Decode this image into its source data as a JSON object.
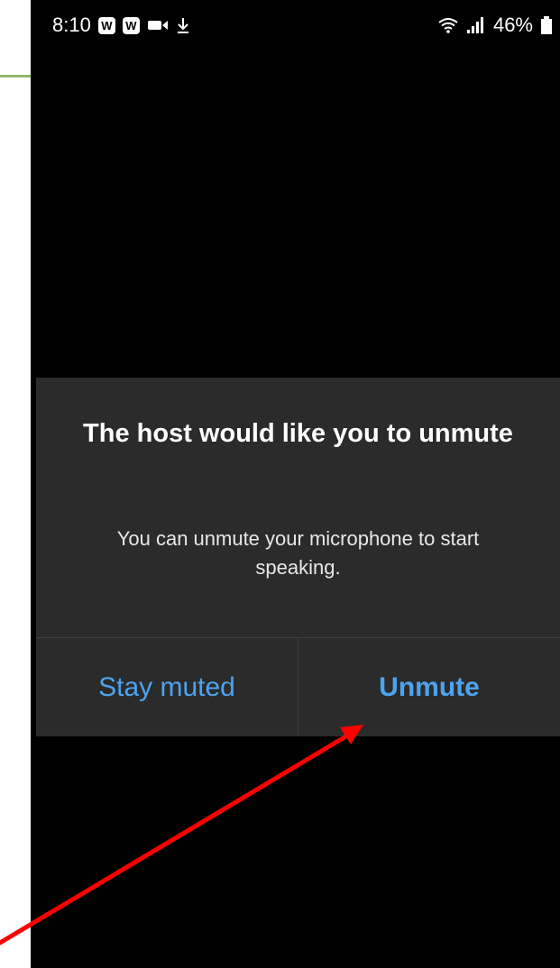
{
  "status_bar": {
    "time": "8:10",
    "notification_badges": [
      "W",
      "W"
    ],
    "icons": [
      "video-camera-icon",
      "download-icon",
      "wifi-icon",
      "signal-icon",
      "battery-icon"
    ],
    "battery_percent": "46%"
  },
  "dialog": {
    "title": "The host would like you to unmute",
    "message": "You can unmute your microphone to start speaking.",
    "buttons": {
      "stay_muted": "Stay muted",
      "unmute": "Unmute"
    }
  },
  "annotation": {
    "arrow_color": "#ff0000",
    "points_to": "unmute-button"
  },
  "colors": {
    "button_text": "#4da3f0",
    "dialog_bg": "#2b2b2b",
    "screen_bg": "#000000"
  }
}
